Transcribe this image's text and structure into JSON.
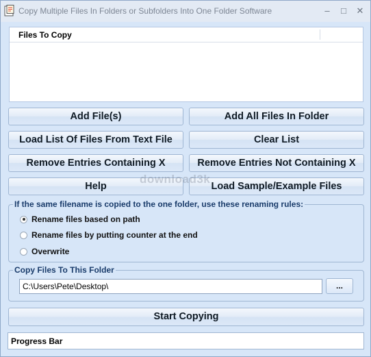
{
  "window": {
    "title": "Copy Multiple Files In Folders or Subfolders Into One Folder Software"
  },
  "titlebar": {
    "minimize": "–",
    "maximize": "□",
    "close": "✕"
  },
  "file_list": {
    "header": "Files To Copy"
  },
  "buttons": {
    "add_files": "Add File(s)",
    "add_all_in_folder": "Add All Files In Folder",
    "load_list": "Load List Of Files From Text File",
    "clear_list": "Clear List",
    "remove_containing": "Remove Entries Containing X",
    "remove_not_containing": "Remove Entries Not Containing X",
    "help": "Help",
    "load_sample": "Load Sample/Example Files",
    "start_copying": "Start Copying",
    "browse": "..."
  },
  "renaming_group": {
    "legend": "If the same filename is copied to the one folder, use these renaming rules:",
    "options": [
      {
        "label": "Rename files based on path",
        "selected": true
      },
      {
        "label": "Rename files by putting counter at the end",
        "selected": false
      },
      {
        "label": "Overwrite",
        "selected": false
      }
    ]
  },
  "destination_group": {
    "legend": "Copy Files To This Folder",
    "path": "C:\\Users\\Pete\\Desktop\\"
  },
  "progress": {
    "label": "Progress Bar"
  },
  "watermark": {
    "text": "download3k"
  },
  "icons": {
    "app": "app-icon"
  }
}
